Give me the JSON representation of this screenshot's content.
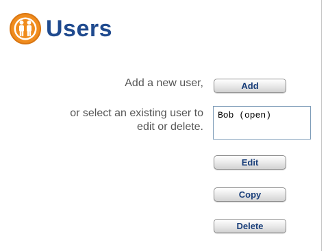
{
  "header": {
    "title": "Users",
    "icon": "users-icon",
    "icon_color": "#f08c1e",
    "title_color": "#1f4a8e"
  },
  "add_section": {
    "prompt": "Add a new user,",
    "button_label": "Add"
  },
  "select_section": {
    "prompt_line1": "or select an existing user to",
    "prompt_line2": "edit or delete.",
    "users": [
      "Bob (open)"
    ]
  },
  "actions": {
    "edit_label": "Edit",
    "copy_label": "Copy",
    "delete_label": "Delete"
  }
}
